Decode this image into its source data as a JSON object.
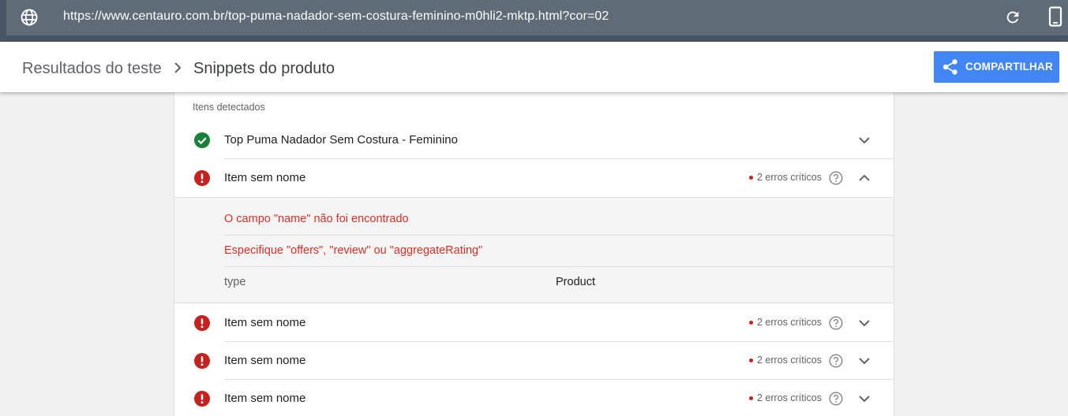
{
  "address_bar": {
    "url": "https://www.centauro.com.br/top-puma-nadador-sem-costura-feminino-m0hli2-mktp.html?cor=02",
    "globe_icon": "globe-icon",
    "reload_icon": "reload-icon",
    "device_icon": "mobile-device-icon"
  },
  "header": {
    "breadcrumb_parent": "Resultados do teste",
    "breadcrumb_current": "Snippets do produto",
    "share_label": "COMPARTILHAR",
    "share_icon": "share-icon",
    "accent_color": "#4285f4"
  },
  "detected": {
    "title": "Itens detectados",
    "items": [
      {
        "label": "Top Puma Nadador Sem Costura - Feminino",
        "status": "valid",
        "errors": "",
        "expanded": false
      },
      {
        "label": "Item sem nome",
        "status": "error",
        "errors": "2 erros críticos",
        "expanded": true
      },
      {
        "label": "Item sem nome",
        "status": "error",
        "errors": "2 erros críticos",
        "expanded": false
      },
      {
        "label": "Item sem nome",
        "status": "error",
        "errors": "2 erros críticos",
        "expanded": false
      },
      {
        "label": "Item sem nome",
        "status": "error",
        "errors": "2 erros críticos",
        "expanded": false
      }
    ],
    "expanded_detail": {
      "errors": [
        "O campo \"name\" não foi encontrado",
        "Especifique \"offers\", \"review\" ou \"aggregateRating\""
      ],
      "property_key": "type",
      "property_value": "Product"
    },
    "colors": {
      "valid": "#188038",
      "error": "#c5221f"
    }
  }
}
